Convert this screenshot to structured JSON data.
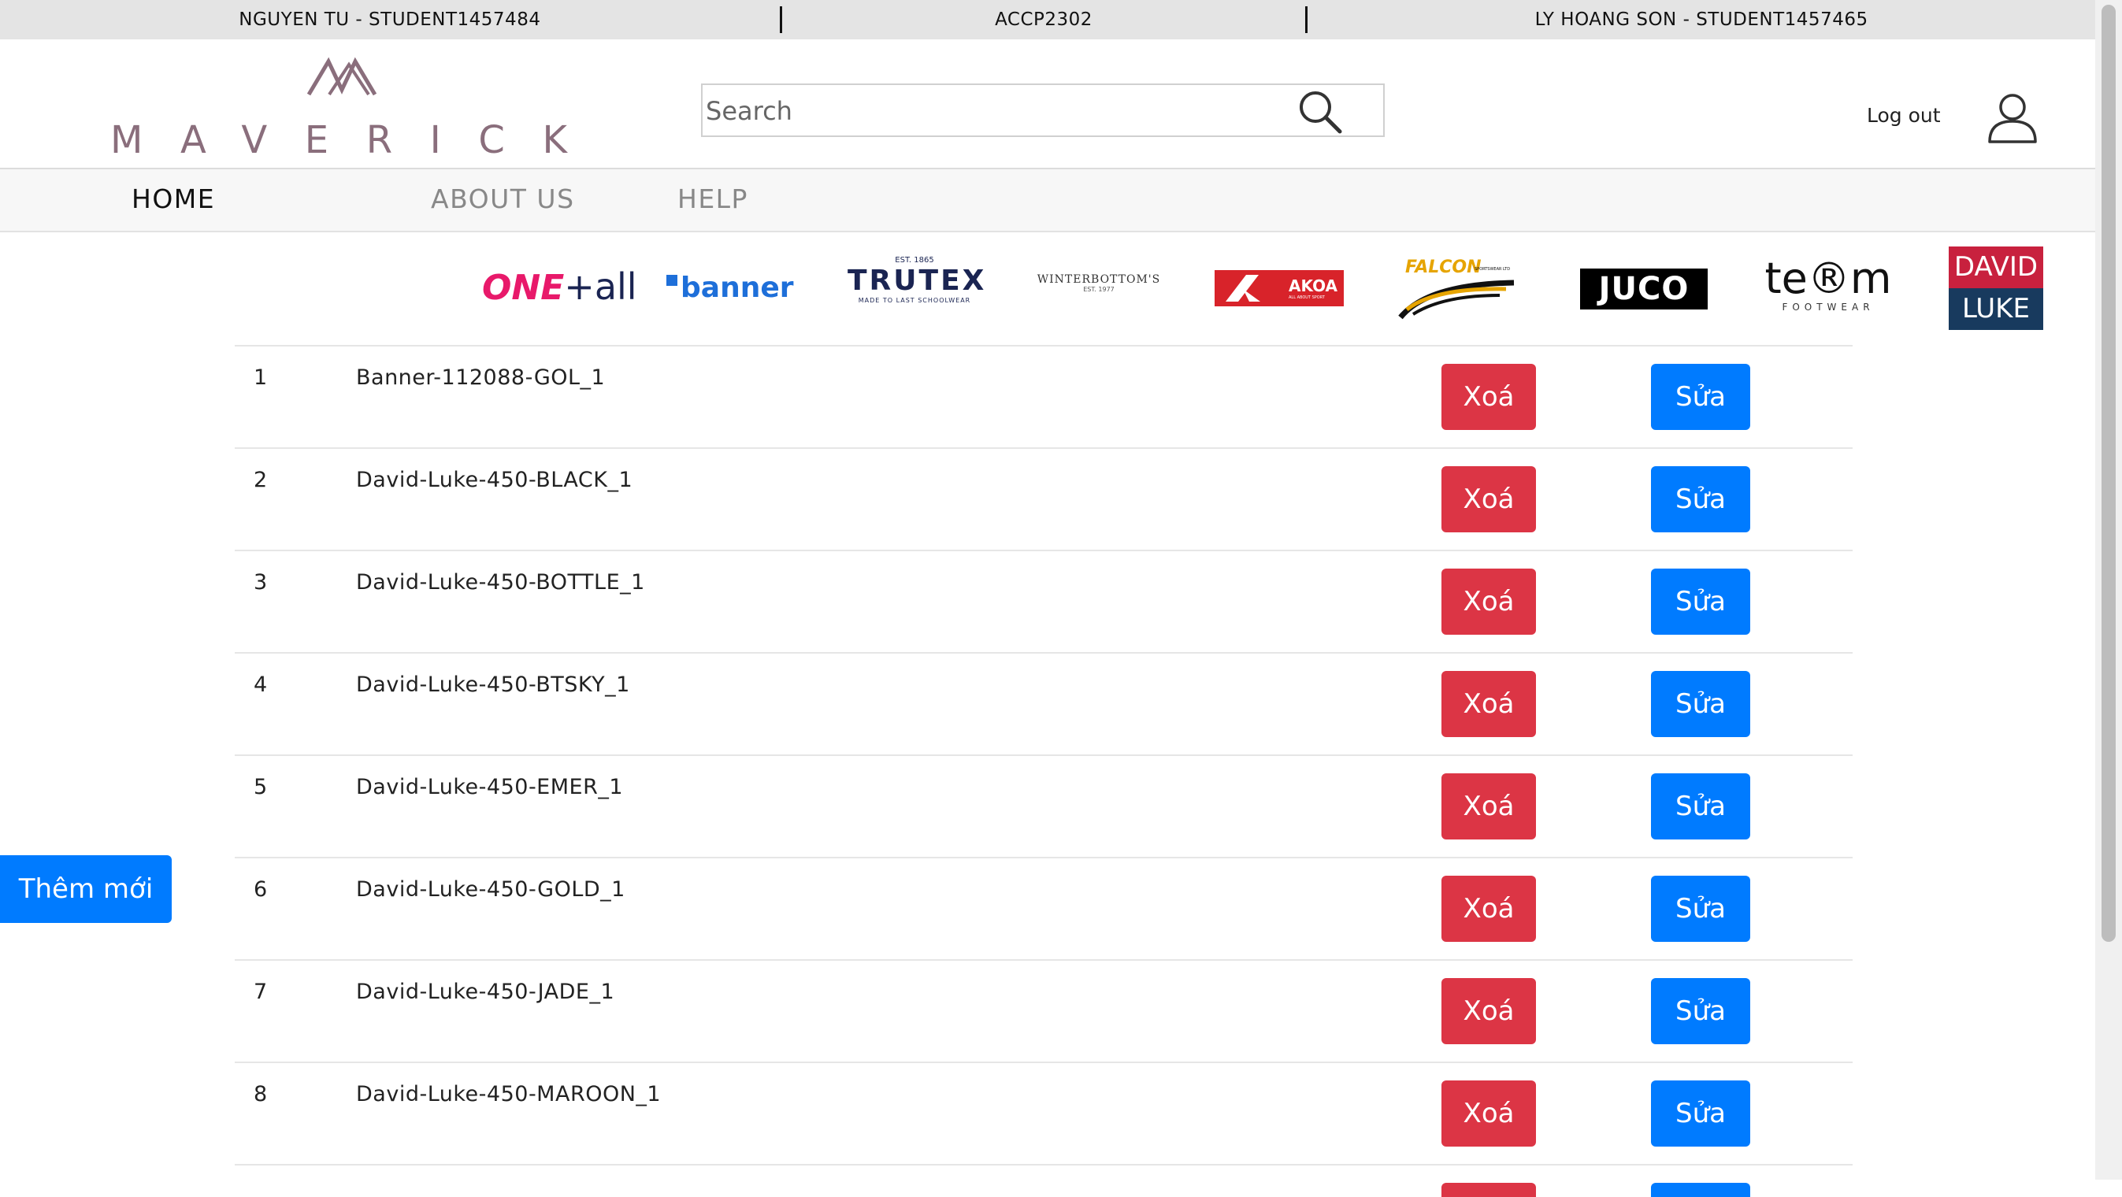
{
  "topbar": {
    "left_text": "NGUYEN TU - STUDENT1457484",
    "center_text": "ACCP2302",
    "right_text": "LY HOANG SON - STUDENT1457465"
  },
  "header": {
    "logo_text": "MAVERICK",
    "search_placeholder": "Search",
    "logout_label": "Log out"
  },
  "nav": {
    "items": [
      {
        "label": "HOME",
        "active": true
      },
      {
        "label": "ABOUT US",
        "active": false
      },
      {
        "label": "HELP",
        "active": false
      }
    ]
  },
  "brands": {
    "oneall": {
      "a": "ONE",
      "b": "+all"
    },
    "banner": "banner",
    "trutex": {
      "est": "EST. 1865",
      "name": "TRUTEX",
      "tagline": "MADE TO LAST SCHOOLWEAR"
    },
    "winterbottoms": {
      "name": "WINTERBOTTOM'S",
      "est": "EST. 1977"
    },
    "akoa": {
      "name": "AKOA",
      "tagline": "ALL ABOUT SPORT"
    },
    "falcon": {
      "name": "FALCON",
      "tagline": "SPORTSWEAR LTD"
    },
    "juco": "JUCO",
    "term": {
      "name": "te®m",
      "sub": "FOOTWEAR"
    },
    "davidluke": {
      "line1": "DAVID",
      "line2": "LUKE"
    }
  },
  "table": {
    "delete_label": "Xoá",
    "edit_label": "Sửa",
    "rows": [
      {
        "index": "1",
        "name": "Banner-112088-GOL_1"
      },
      {
        "index": "2",
        "name": "David-Luke-450-BLACK_1"
      },
      {
        "index": "3",
        "name": "David-Luke-450-BOTTLE_1"
      },
      {
        "index": "4",
        "name": "David-Luke-450-BTSKY_1"
      },
      {
        "index": "5",
        "name": "David-Luke-450-EMER_1"
      },
      {
        "index": "6",
        "name": "David-Luke-450-GOLD_1"
      },
      {
        "index": "7",
        "name": "David-Luke-450-JADE_1"
      },
      {
        "index": "8",
        "name": "David-Luke-450-MAROON_1"
      }
    ]
  },
  "add_button_label": "Thêm mới",
  "colors": {
    "delete": "#dc3545",
    "edit": "#007bff",
    "logo": "#8a6e7c",
    "topbar": "#e4e4e4"
  }
}
